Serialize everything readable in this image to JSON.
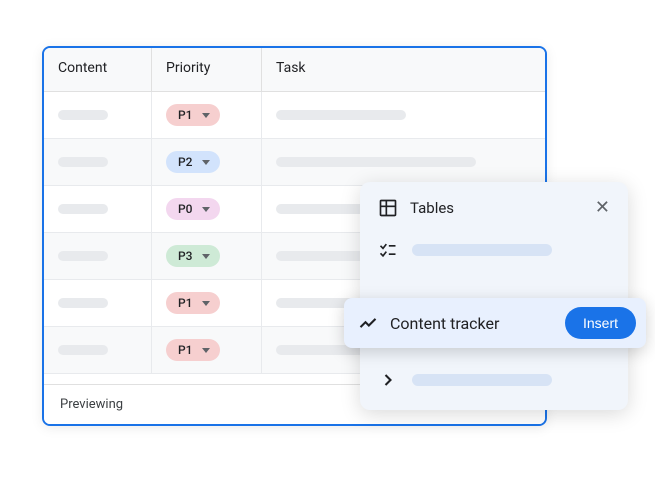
{
  "table": {
    "headers": {
      "content": "Content",
      "priority": "Priority",
      "task": "Task"
    },
    "rows": [
      {
        "priority": "P1",
        "chipClass": "chip-p1"
      },
      {
        "priority": "P2",
        "chipClass": "chip-p2"
      },
      {
        "priority": "P0",
        "chipClass": "chip-p0"
      },
      {
        "priority": "P3",
        "chipClass": "chip-p3"
      },
      {
        "priority": "P1",
        "chipClass": "chip-p1"
      },
      {
        "priority": "P1",
        "chipClass": "chip-p1"
      }
    ],
    "status": "Previewing"
  },
  "popover": {
    "title": "Tables",
    "highlighted": {
      "label": "Content tracker",
      "button": "Insert"
    }
  }
}
